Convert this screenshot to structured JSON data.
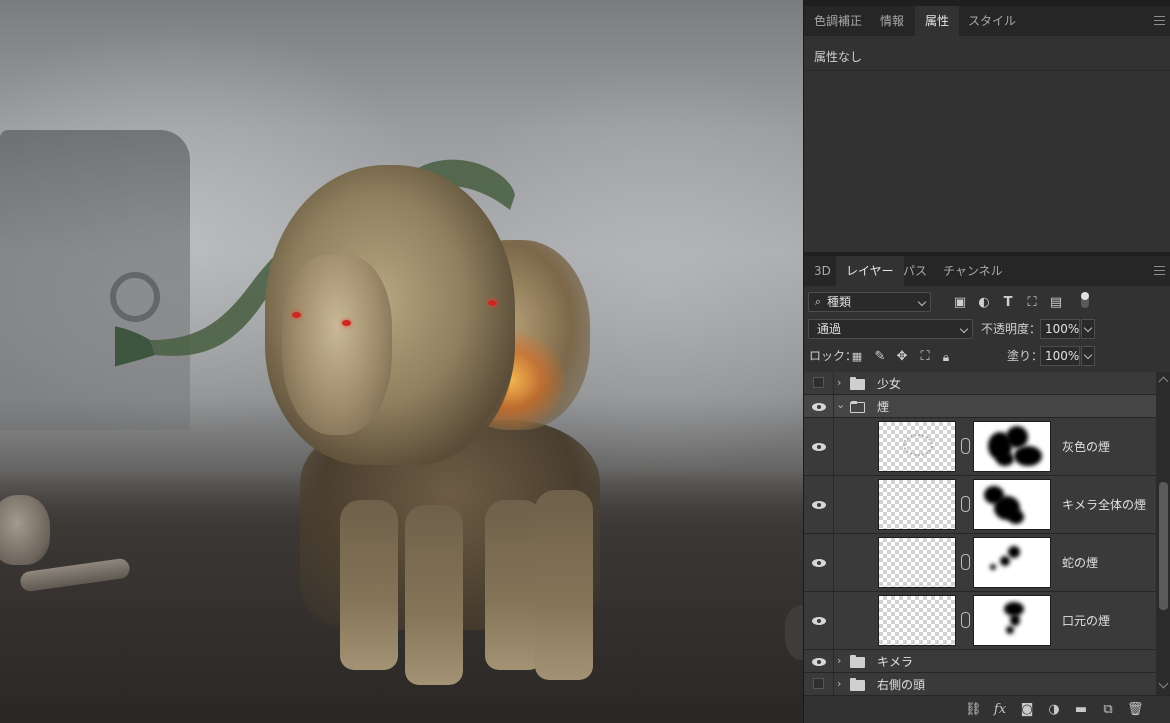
{
  "properties_panel": {
    "tabs": [
      "色調補正",
      "情報",
      "属性",
      "スタイル"
    ],
    "active_tab": "属性",
    "content_label": "属性なし"
  },
  "layers_panel": {
    "tabs": [
      "3D",
      "レイヤー",
      "パス",
      "チャンネル"
    ],
    "active_tab": "レイヤー",
    "filter_kind": "種類",
    "blend_mode": "通過",
    "opacity_label": "不透明度：",
    "opacity_value": "100%",
    "lock_label": "ロック：",
    "fill_label": "塗り：",
    "fill_value": "100%",
    "layers": [
      {
        "name": "少女",
        "type": "group",
        "visible": false,
        "expanded": false
      },
      {
        "name": "煙",
        "type": "group",
        "visible": true,
        "expanded": true,
        "selected": true
      },
      {
        "name": "灰色の煙",
        "type": "layer",
        "visible": true,
        "has_mask": true
      },
      {
        "name": "キメラ全体の煙",
        "type": "layer",
        "visible": true,
        "has_mask": true
      },
      {
        "name": "蛇の煙",
        "type": "layer",
        "visible": true,
        "has_mask": true
      },
      {
        "name": "口元の煙",
        "type": "layer",
        "visible": true,
        "has_mask": true
      },
      {
        "name": "キメラ",
        "type": "group",
        "visible": true,
        "expanded": false
      },
      {
        "name": "右側の頭",
        "type": "group",
        "visible": false,
        "expanded": false
      }
    ],
    "bottom_icons": [
      "link-layers-icon",
      "fx-icon",
      "add-mask-icon",
      "adjustment-layer-icon",
      "new-group-icon",
      "new-layer-icon",
      "trash-icon"
    ],
    "fx_label": "fx"
  }
}
